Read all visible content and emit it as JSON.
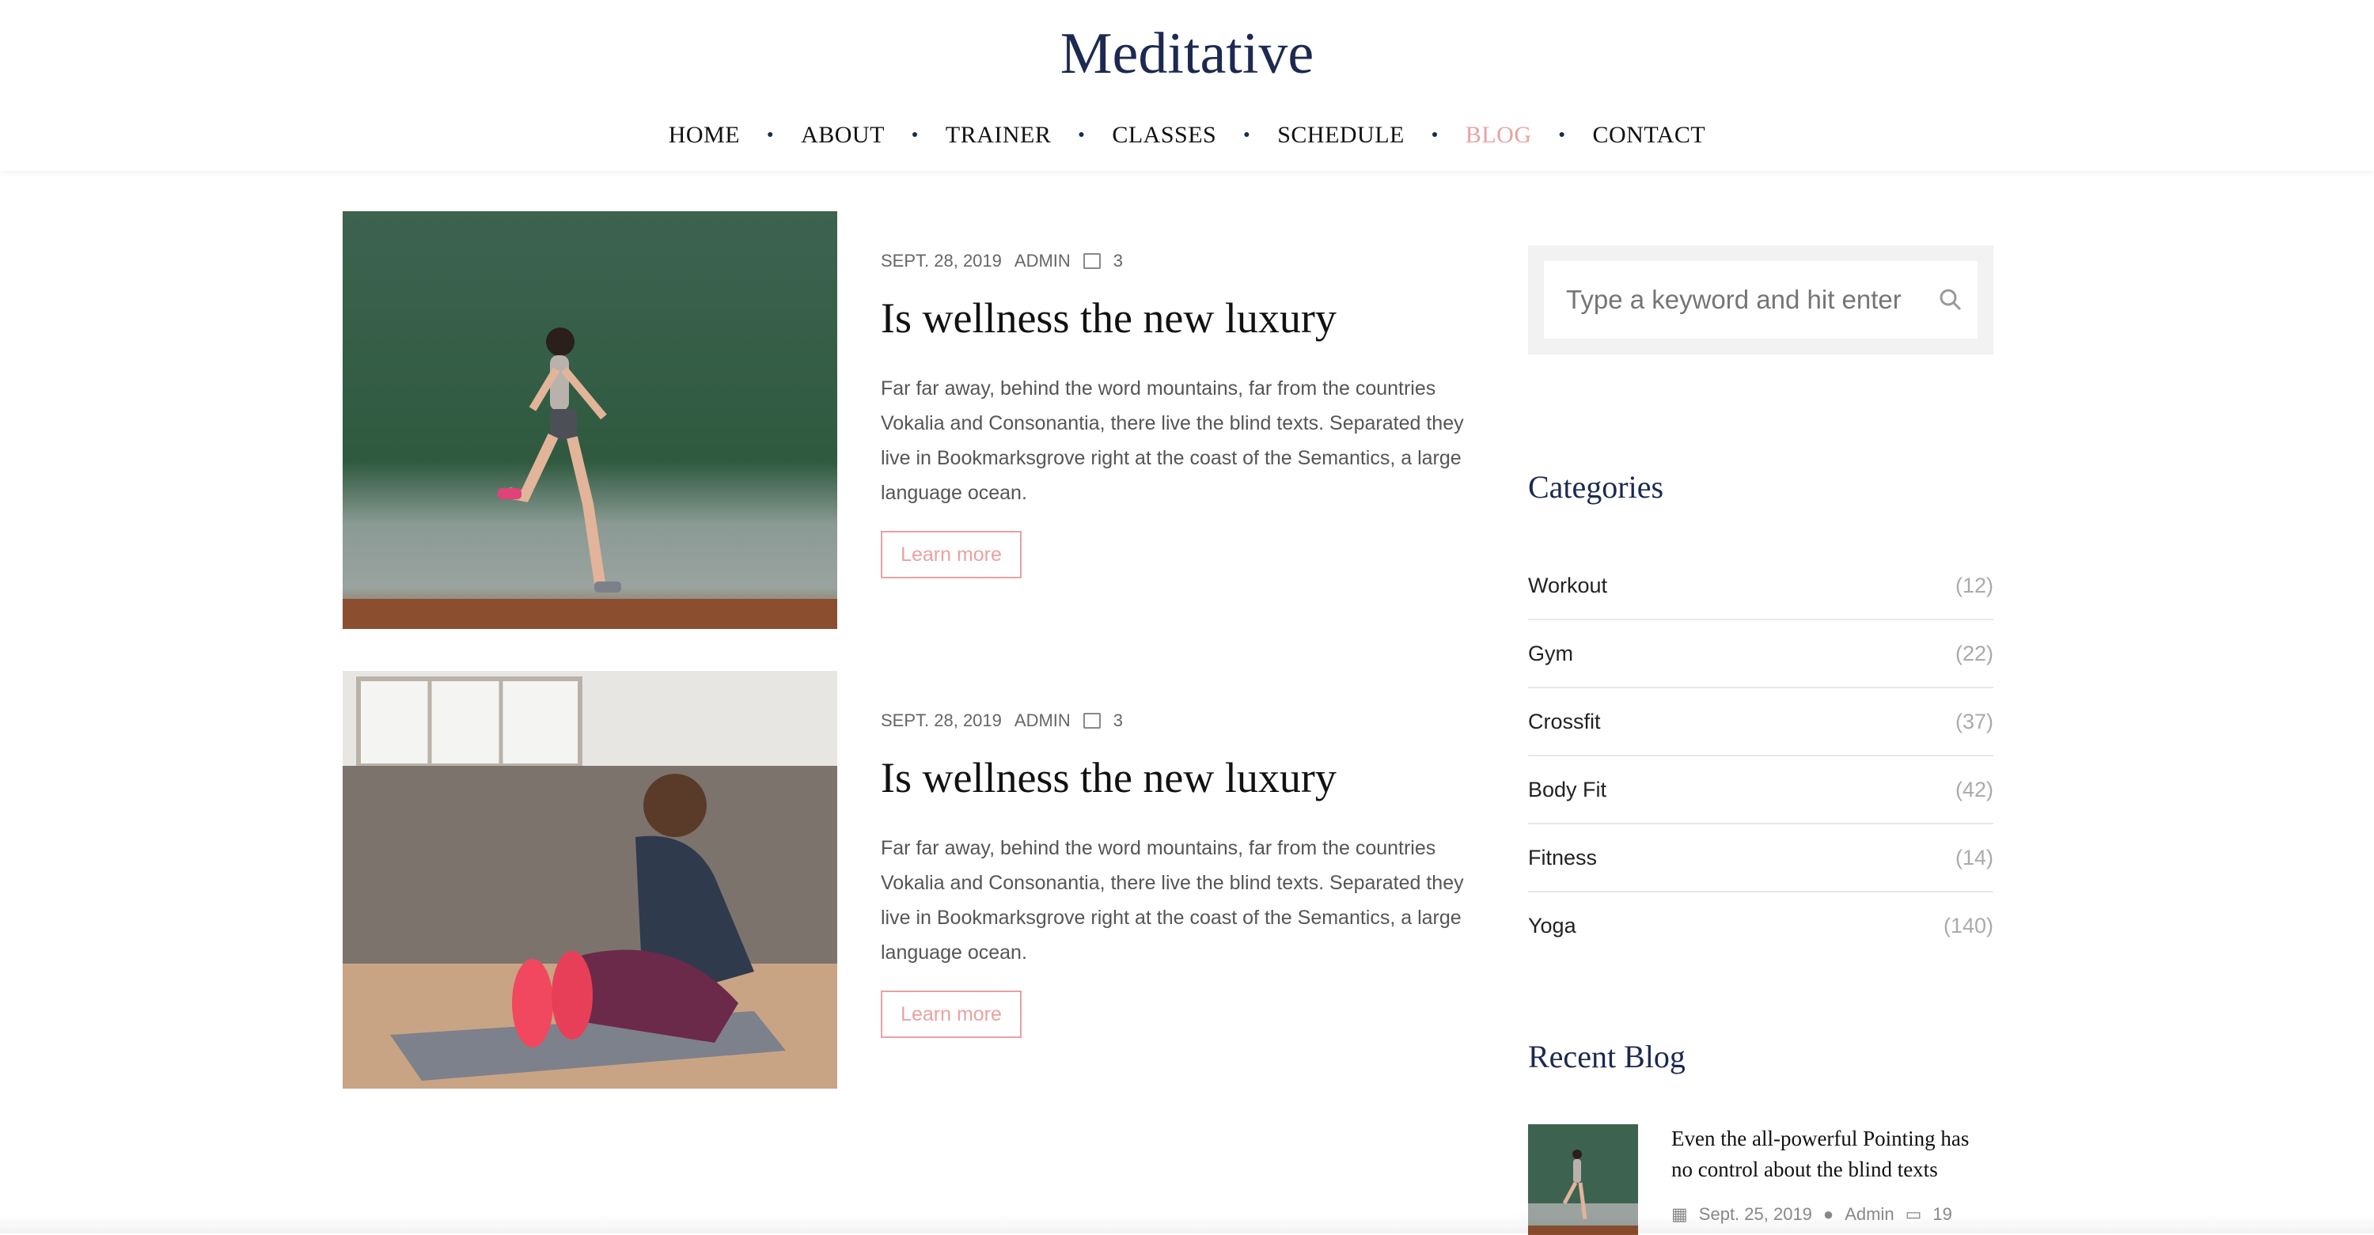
{
  "brand": "Meditative",
  "nav": {
    "items": [
      "HOME",
      "ABOUT",
      "TRAINER",
      "CLASSES",
      "SCHEDULE",
      "BLOG",
      "CONTACT"
    ],
    "active": "BLOG"
  },
  "posts": [
    {
      "date": "SEPT. 28, 2019",
      "author": "ADMIN",
      "comments": "3",
      "title": "Is wellness the new luxury",
      "excerpt": "Far far away, behind the word mountains, far from the countries Vokalia and Consonantia, there live the blind texts. Separated they live in Bookmarksgrove right at the coast of the Semantics, a large language ocean.",
      "button": "Learn more"
    },
    {
      "date": "SEPT. 28, 2019",
      "author": "ADMIN",
      "comments": "3",
      "title": "Is wellness the new luxury",
      "excerpt": "Far far away, behind the word mountains, far from the countries Vokalia and Consonantia, there live the blind texts. Separated they live in Bookmarksgrove right at the coast of the Semantics, a large language ocean.",
      "button": "Learn more"
    }
  ],
  "search": {
    "placeholder": "Type a keyword and hit enter"
  },
  "categories": {
    "heading": "Categories",
    "items": [
      {
        "label": "Workout",
        "count": "(12)"
      },
      {
        "label": "Gym",
        "count": "(22)"
      },
      {
        "label": "Crossfit",
        "count": "(37)"
      },
      {
        "label": "Body Fit",
        "count": "(42)"
      },
      {
        "label": "Fitness",
        "count": "(14)"
      },
      {
        "label": "Yoga",
        "count": "(140)"
      }
    ]
  },
  "recent": {
    "heading": "Recent Blog",
    "items": [
      {
        "title": "Even the all-powerful Pointing has no control about the blind texts",
        "date": "Sept. 25, 2019",
        "author": "Admin",
        "comments": "19"
      }
    ]
  },
  "colors": {
    "brand": "#1c2951",
    "accent": "#e8a2a2"
  }
}
